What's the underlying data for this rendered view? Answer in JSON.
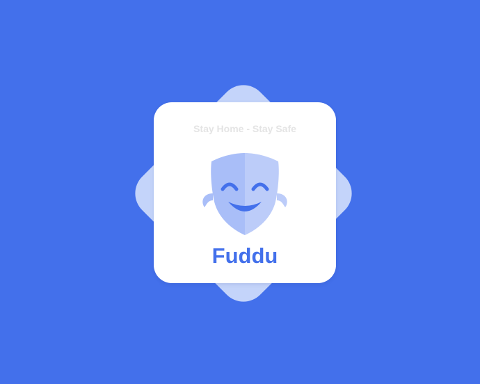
{
  "splash": {
    "tagline": "Stay Home - Stay Safe",
    "logo_icon": "comedy-mask-icon",
    "app_name": "Fuddu"
  },
  "colors": {
    "background": "#4370EB",
    "diamond": "#C4D4FA",
    "card": "#FFFFFF",
    "accent": "#4370EB",
    "tagline": "#E4E4E4",
    "mask_left": "#A9BEF8",
    "mask_right": "#BCCCF9"
  }
}
